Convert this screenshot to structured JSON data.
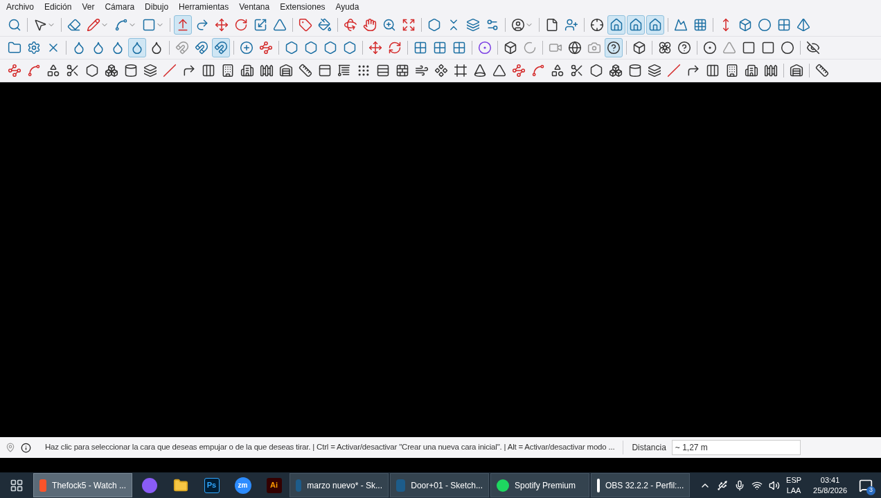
{
  "menu": [
    "Archivo",
    "Edición",
    "Ver",
    "Cámara",
    "Dibujo",
    "Herramientas",
    "Ventana",
    "Extensiones",
    "Ayuda"
  ],
  "toolbars": [
    {
      "tools": [
        {
          "selected": false
        },
        {
          "selected": false
        },
        {
          "selected": false
        },
        {
          "selected": false
        },
        {
          "selected": false
        },
        {
          "selected": false
        },
        {
          "selected": true
        },
        {
          "selected": false
        },
        {
          "selected": false
        },
        {
          "selected": false
        },
        {
          "selected": false
        },
        {
          "selected": false
        },
        {
          "selected": false
        },
        {
          "selected": false
        },
        {
          "selected": false
        },
        {
          "selected": false
        },
        {
          "selected": false
        },
        {
          "selected": false
        },
        {
          "selected": false
        },
        {
          "selected": false
        },
        {
          "selected": false
        },
        {
          "selected": false
        },
        {
          "selected": false
        },
        {
          "selected": false
        },
        {
          "selected": false
        },
        {
          "selected": false
        },
        {
          "selected": true
        },
        {
          "selected": true
        },
        {
          "selected": true
        },
        {
          "selected": false
        },
        {
          "selected": false
        },
        {
          "selected": false
        },
        {
          "selected": false
        },
        {
          "selected": false
        },
        {
          "selected": false
        },
        {
          "selected": false
        }
      ]
    },
    {
      "tools": [
        {
          "selected": false
        },
        {
          "selected": false
        },
        {
          "selected": false
        },
        {
          "selected": false
        },
        {
          "selected": false
        },
        {
          "selected": false
        },
        {
          "selected": true
        },
        {
          "selected": false
        },
        {
          "selected": false
        },
        {
          "selected": false
        },
        {
          "selected": true
        },
        {
          "selected": false
        },
        {
          "selected": false
        },
        {
          "selected": false
        },
        {
          "selected": false
        },
        {
          "selected": false
        },
        {
          "selected": false
        },
        {
          "selected": false
        },
        {
          "selected": false
        },
        {
          "selected": false
        },
        {
          "selected": false
        },
        {
          "selected": false
        },
        {
          "selected": false
        },
        {
          "selected": false
        },
        {
          "selected": false
        },
        {
          "selected": false
        },
        {
          "selected": false
        },
        {
          "selected": false
        },
        {
          "selected": true
        },
        {
          "selected": false
        },
        {
          "selected": false
        },
        {
          "selected": false
        },
        {
          "selected": false
        },
        {
          "selected": false
        },
        {
          "selected": false
        },
        {
          "selected": false
        },
        {
          "selected": false
        },
        {
          "selected": false
        }
      ]
    },
    {
      "tools": [
        {
          "selected": false
        },
        {
          "selected": false
        },
        {
          "selected": false
        },
        {
          "selected": false
        },
        {
          "selected": false
        },
        {
          "selected": false
        },
        {
          "selected": false
        },
        {
          "selected": false
        },
        {
          "selected": false
        },
        {
          "selected": false
        },
        {
          "selected": false
        },
        {
          "selected": false
        },
        {
          "selected": false
        },
        {
          "selected": false
        },
        {
          "selected": false
        },
        {
          "selected": false
        },
        {
          "selected": false
        },
        {
          "selected": false
        },
        {
          "selected": false
        },
        {
          "selected": false
        },
        {
          "selected": false
        },
        {
          "selected": false
        },
        {
          "selected": false
        },
        {
          "selected": false
        },
        {
          "selected": false
        },
        {
          "selected": false
        },
        {
          "selected": false
        },
        {
          "selected": false
        },
        {
          "selected": false
        },
        {
          "selected": false
        },
        {
          "selected": false
        },
        {
          "selected": false
        },
        {
          "selected": false
        },
        {
          "selected": false
        },
        {
          "selected": false
        },
        {
          "selected": false
        },
        {
          "selected": false
        },
        {
          "selected": false
        },
        {
          "selected": false
        },
        {
          "selected": false
        },
        {
          "selected": false
        },
        {
          "selected": false
        }
      ]
    }
  ],
  "status_bar": {
    "hint": "Haz clic para seleccionar la cara que deseas empujar o de la que deseas tirar. | Ctrl = Activar/desactivar \"Crear una nueva cara inicial\". | Alt = Activar/desactivar modo ...",
    "distance_label": "Distancia",
    "distance_value": "~ 1,27 m"
  },
  "taskbar": {
    "items": [
      {
        "kind": "browser",
        "label": "Thefock5 - Watch ...",
        "selected": true
      },
      {
        "kind": "proton"
      },
      {
        "kind": "folder"
      },
      {
        "kind": "ps",
        "text": "Ps"
      },
      {
        "kind": "zoom",
        "text": "zm"
      },
      {
        "kind": "ai",
        "text": "Ai"
      },
      {
        "kind": "sketchup",
        "label": "marzo nuevo* - Sk...",
        "selected": false
      },
      {
        "kind": "sketchup",
        "label": "Door+01 - Sketch...",
        "selected": false
      },
      {
        "kind": "spotify",
        "label": "Spotify Premium",
        "selected": false
      },
      {
        "kind": "obs",
        "label": "OBS 32.2.2 - Perfil:...",
        "selected": false
      }
    ],
    "language": "ESP",
    "layout": "LAA",
    "time": "03:41",
    "date": "25/8/2026",
    "notifications": "3"
  }
}
